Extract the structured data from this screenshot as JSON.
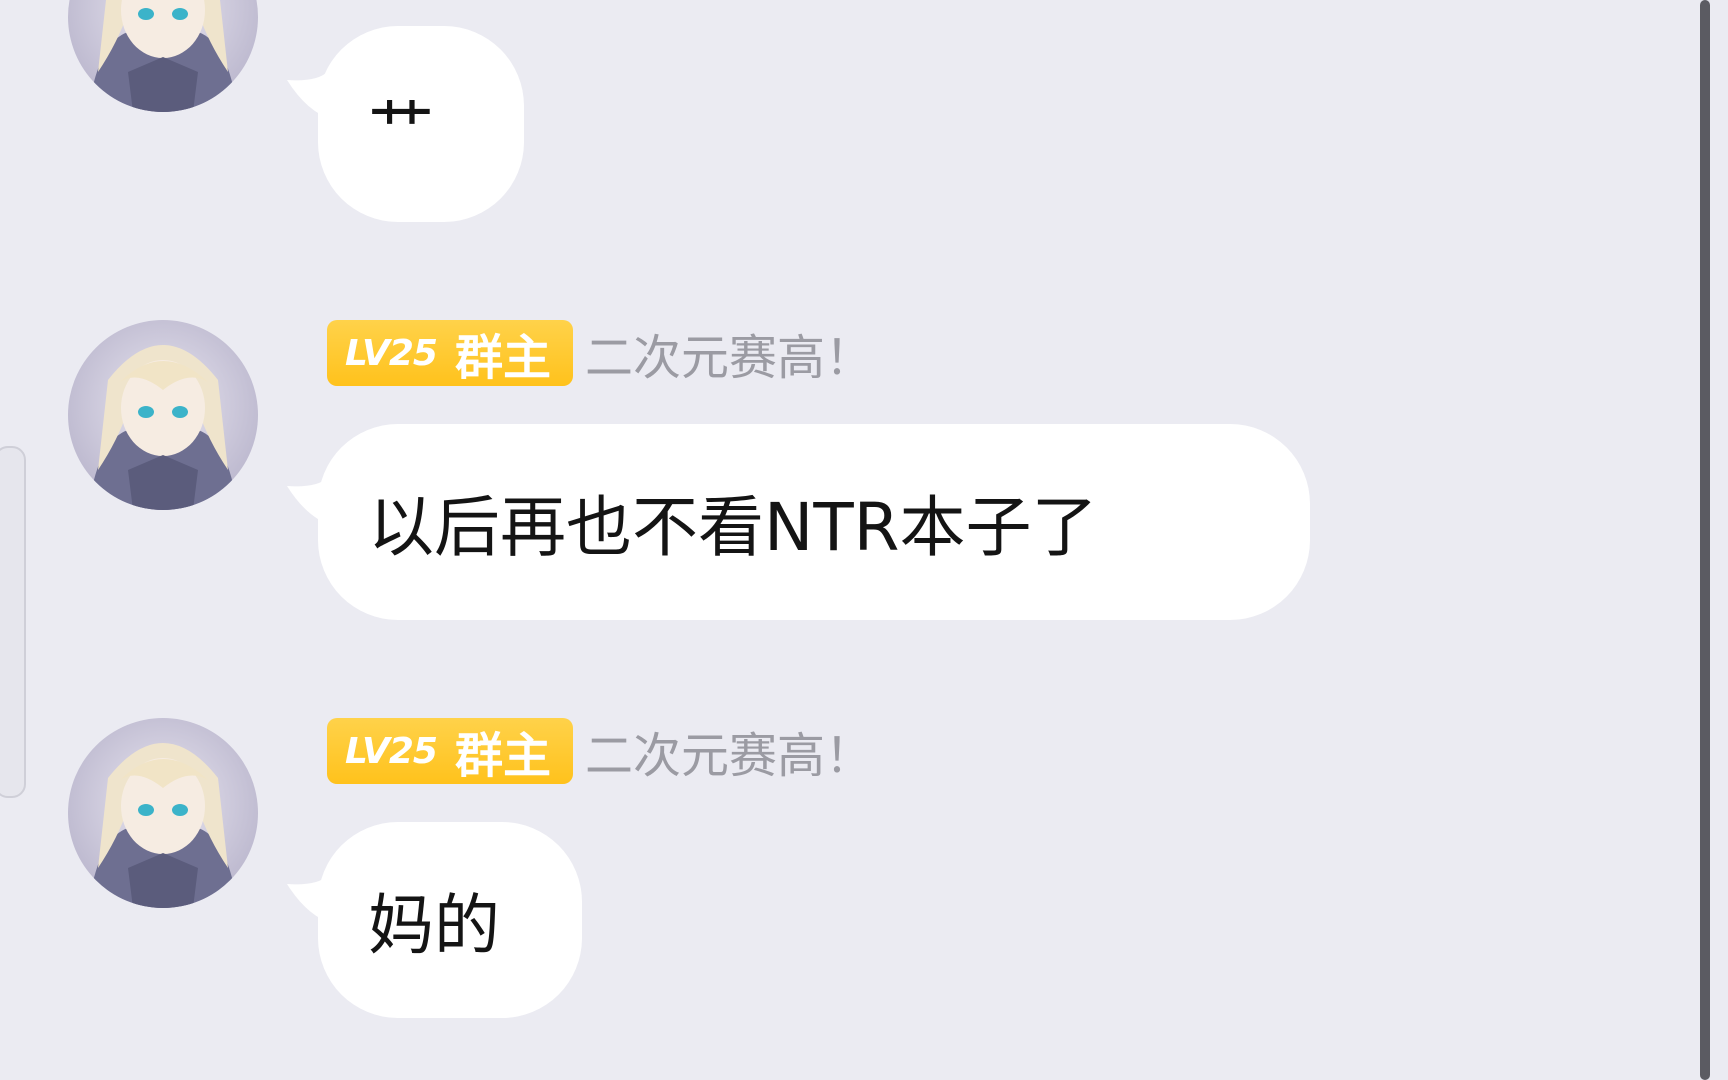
{
  "messages": [
    {
      "text": "艹",
      "show_header": false
    },
    {
      "level_badge": "LV25",
      "role_badge": "群主",
      "nickname": "二次元赛高！",
      "text": "以后再也不看NTR本子了",
      "show_header": true
    },
    {
      "level_badge": "LV25",
      "role_badge": "群主",
      "nickname": "二次元赛高！",
      "text": "妈的",
      "show_header": true
    }
  ],
  "colors": {
    "background": "#ebebf2",
    "bubble": "#ffffff",
    "badge": "#ffc21c",
    "nickname": "#9b9ba3",
    "message_text": "#141414",
    "scrollbar_thumb": "#5b5b62"
  },
  "icons": {
    "avatar": "anime-girl-avatar"
  }
}
